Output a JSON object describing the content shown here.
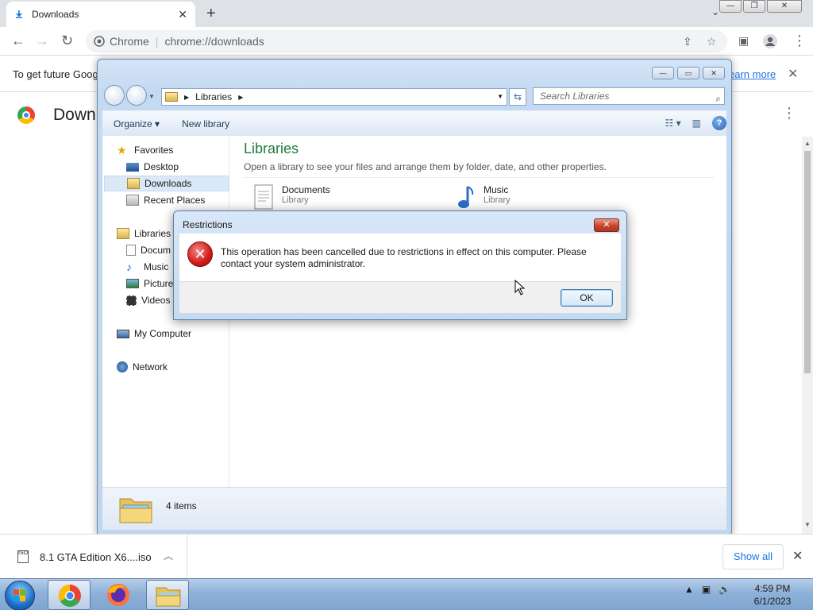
{
  "chrome": {
    "tab_title": "Downloads",
    "omnibox_site": "Chrome",
    "omnibox_url": "chrome://downloads",
    "infobar_text": "To get future Goog",
    "infobar_link": "earn more",
    "page_title": "Down"
  },
  "explorer": {
    "breadcrumb": "Libraries",
    "search_placeholder": "Search Libraries",
    "organize_label": "Organize",
    "new_library_label": "New library",
    "nav": {
      "favorites": "Favorites",
      "desktop": "Desktop",
      "downloads": "Downloads",
      "recent_places": "Recent Places",
      "libraries": "Libraries",
      "documents": "Docum",
      "music": "Music",
      "pictures": "Picture",
      "videos": "Videos",
      "my_computer": "My Computer",
      "network": "Network"
    },
    "main_title": "Libraries",
    "main_subtitle": "Open a library to see your files and arrange them by folder, date, and other properties.",
    "library_items": [
      {
        "name": "Documents",
        "type": "Library"
      },
      {
        "name": "Music",
        "type": "Library"
      }
    ],
    "items_count": "4 items"
  },
  "dialog": {
    "title": "Restrictions",
    "message": "This operation has been cancelled due to restrictions in effect on this computer. Please contact your system administrator.",
    "ok_label": "OK"
  },
  "download_shelf": {
    "file_name": "8.1 GTA Edition X6....iso",
    "file_icon_label": "ISO",
    "show_all_label": "Show all"
  },
  "taskbar": {
    "time": "4:59 PM",
    "date": "6/1/2023"
  },
  "colors": {
    "chrome_blue": "#1a73e8",
    "libraries_title_green": "#1e7b34",
    "error_red": "#d11919",
    "taskbar_blue": "#8eb1d9"
  }
}
